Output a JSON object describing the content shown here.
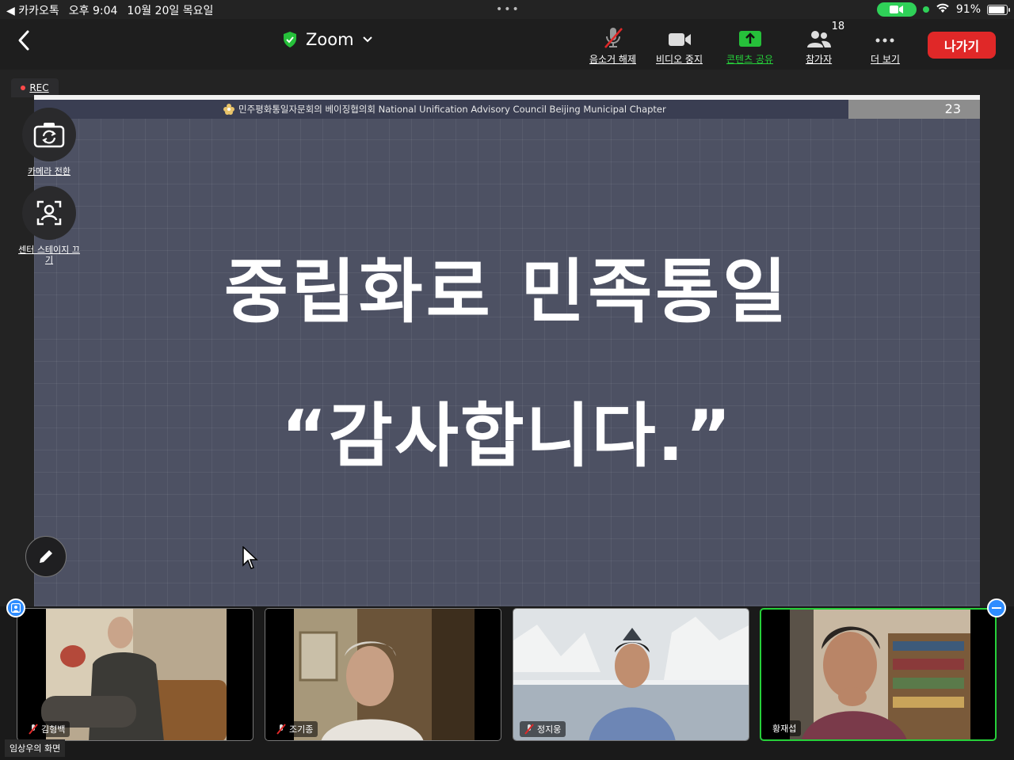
{
  "status_bar": {
    "back_app": "◀ 카카오톡",
    "time": "오후 9:04",
    "date": "10월 20일 목요일",
    "battery": "91%",
    "battery_level": 0.91
  },
  "toolbar": {
    "title": "Zoom",
    "mute_label": "음소거 해제",
    "video_label": "비디오 중지",
    "share_label": "콘텐츠 공유",
    "participants_label": "참가자",
    "participants_count": "18",
    "more_label": "더 보기",
    "leave_label": "나가기"
  },
  "rec_label": "REC",
  "side_controls": {
    "switch_camera": "카메라 전환",
    "center_stage": "센터 스테이지 끄기"
  },
  "slide": {
    "org": "민주평화통일자문회의 베이징협의회 National Unification Advisory Council Beijing Municipal Chapter",
    "page": "23",
    "title": "중립화로 민족통일",
    "thanks": "“감사합니다.”"
  },
  "participants": [
    {
      "name": "김형백",
      "muted": true
    },
    {
      "name": "조기종",
      "muted": true
    },
    {
      "name": "정지웅",
      "muted": true
    },
    {
      "name": "황재섭",
      "muted": false,
      "active": true
    }
  ],
  "screen_owner": "임상우의 화면",
  "colors": {
    "leave": "#e02828",
    "share": "#26d03a",
    "active_speaker": "#26d03a",
    "slide_bg": "#4d5163"
  }
}
